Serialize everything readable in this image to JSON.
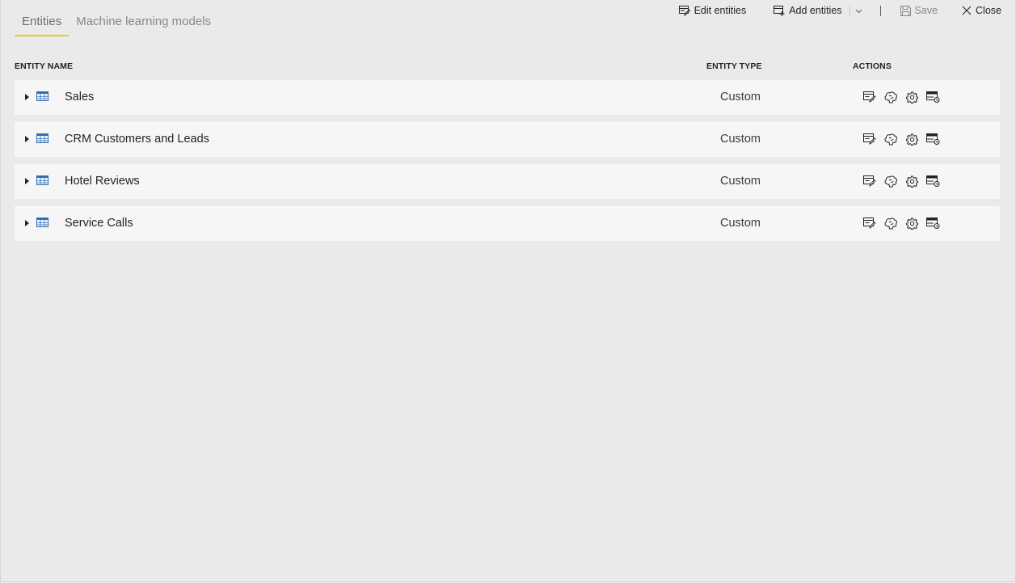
{
  "tabs": [
    {
      "label": "Entities",
      "active": true
    },
    {
      "label": "Machine learning models",
      "active": false
    }
  ],
  "toolbar": {
    "edit_label": "Edit entities",
    "add_label": "Add entities",
    "save_label": "Save",
    "close_label": "Close"
  },
  "columns": {
    "name": "ENTITY NAME",
    "type": "ENTITY TYPE",
    "actions": "ACTIONS"
  },
  "entities": [
    {
      "name": "Sales",
      "type": "Custom"
    },
    {
      "name": "CRM Customers and Leads",
      "type": "Custom"
    },
    {
      "name": "Hotel Reviews",
      "type": "Custom"
    },
    {
      "name": "Service Calls",
      "type": "Custom"
    }
  ],
  "row_actions": [
    "edit-entity-icon",
    "brain-icon",
    "gear-icon",
    "incremental-refresh-icon"
  ],
  "colors": {
    "accent": "#f2c811",
    "table_icon": "#2f6fb5",
    "background": "#eaeaea",
    "row": "#f6f6f6"
  }
}
